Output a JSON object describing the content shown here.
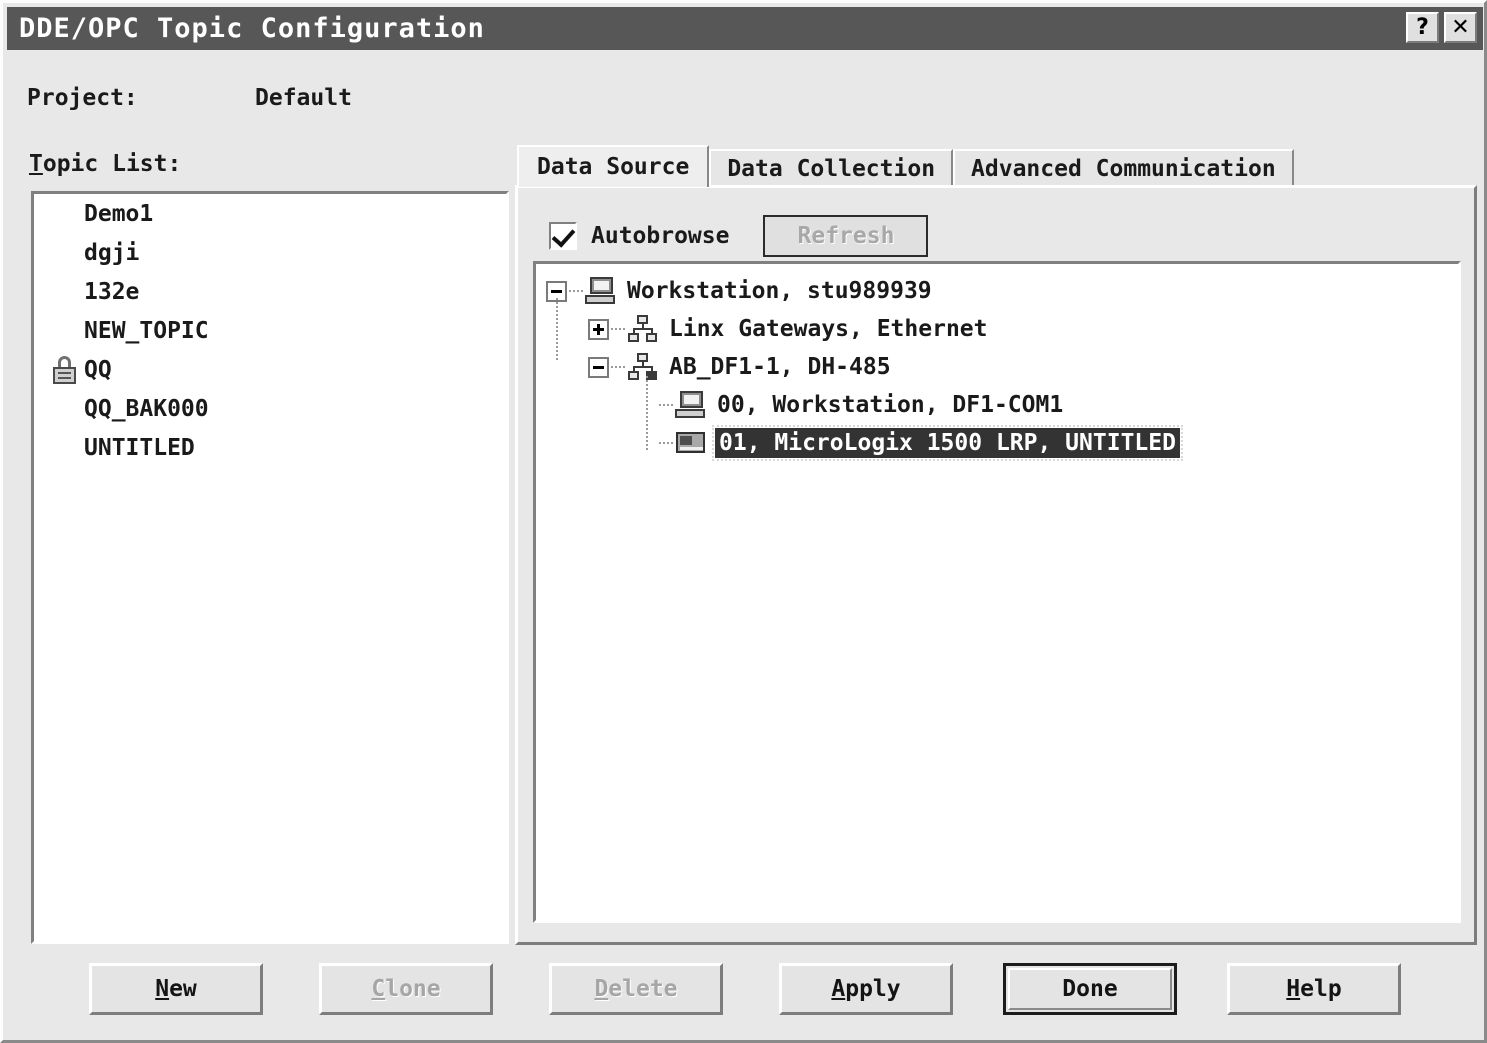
{
  "window": {
    "title": "DDE/OPC Topic Configuration",
    "titlebar_buttons": [
      {
        "name": "help-button",
        "glyph": "?"
      },
      {
        "name": "close-button",
        "glyph": "✕"
      }
    ]
  },
  "project": {
    "label": "Project:",
    "value": "Default"
  },
  "topic_list": {
    "label_prefix": "T",
    "label_rest": "opic List:",
    "items": [
      {
        "name": "Demo1",
        "locked": false
      },
      {
        "name": "dgji",
        "locked": false
      },
      {
        "name": "132e",
        "locked": false
      },
      {
        "name": "NEW_TOPIC",
        "locked": false
      },
      {
        "name": "QQ",
        "locked": true
      },
      {
        "name": "QQ_BAK000",
        "locked": false
      },
      {
        "name": "UNTITLED",
        "locked": false
      }
    ]
  },
  "tabs": [
    {
      "label": "Data Source",
      "active": true
    },
    {
      "label": "Data Collection",
      "active": false
    },
    {
      "label": "Advanced Communication",
      "active": false
    }
  ],
  "data_source": {
    "autobrowse_label": "Autobrowse",
    "autobrowse_checked": true,
    "refresh_label": "Refresh",
    "refresh_enabled": false,
    "tree": [
      {
        "label": "Workstation, stu989939",
        "icon": "computer-icon",
        "expander": "minus",
        "depth": 0
      },
      {
        "label": "Linx Gateways, Ethernet",
        "icon": "network-icon",
        "expander": "plus",
        "depth": 1
      },
      {
        "label": "AB_DF1-1, DH-485",
        "icon": "network-icon-filled",
        "expander": "minus",
        "depth": 1
      },
      {
        "label": "00, Workstation, DF1-COM1",
        "icon": "computer-icon",
        "expander": "none",
        "depth": 2
      },
      {
        "label": "01, MicroLogix 1500 LRP, UNTITLED",
        "icon": "plc-icon",
        "expander": "none",
        "depth": 2,
        "selected": true
      }
    ]
  },
  "buttons": [
    {
      "name": "new-button",
      "accel": "N",
      "rest": "ew",
      "pre": "",
      "enabled": true,
      "default": false
    },
    {
      "name": "clone-button",
      "accel": "C",
      "rest": "lone",
      "pre": "",
      "enabled": false,
      "default": false
    },
    {
      "name": "delete-button",
      "accel": "D",
      "rest": "elete",
      "pre": "",
      "enabled": false,
      "default": false
    },
    {
      "name": "apply-button",
      "accel": "A",
      "rest": "pply",
      "pre": "",
      "enabled": true,
      "default": false
    },
    {
      "name": "done-button",
      "accel": "",
      "rest": "Done",
      "pre": "",
      "enabled": true,
      "default": true
    },
    {
      "name": "help-button",
      "accel": "H",
      "rest": "elp",
      "pre": "",
      "enabled": true,
      "default": false
    }
  ],
  "colors": {
    "titlebar_bg": "#575757",
    "face": "#e8e8e8",
    "field_bg": "#ffffff",
    "selection_bg": "#333333",
    "selection_fg": "#ffffff",
    "disabled_fg": "#a6a6a6"
  }
}
